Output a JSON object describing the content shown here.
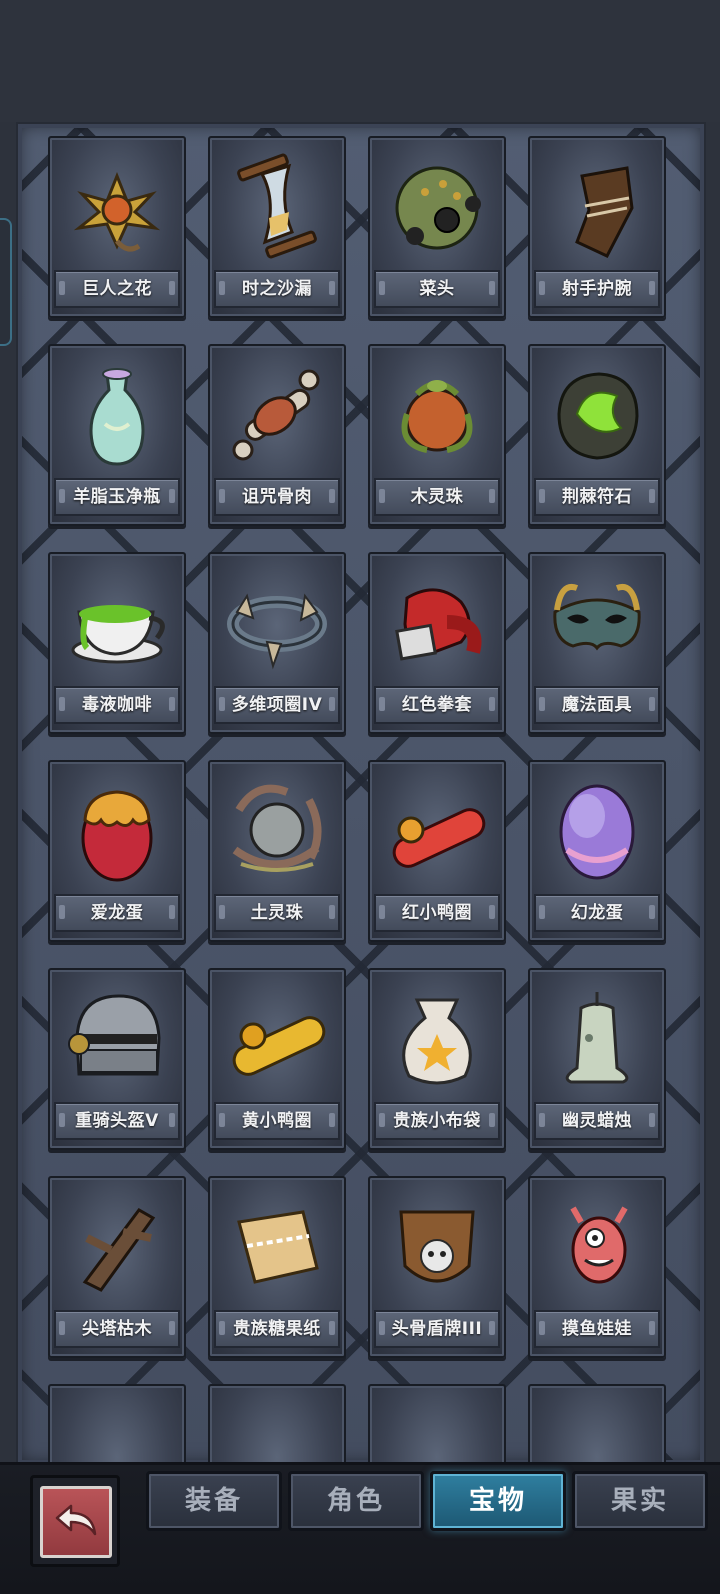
{
  "tabs": [
    {
      "label": "装备"
    },
    {
      "label": "角色"
    },
    {
      "label": "宝物"
    },
    {
      "label": "果实"
    }
  ],
  "active_tab": "宝物",
  "items": [
    {
      "name": "巨人之花",
      "icon": "giant-flower-icon"
    },
    {
      "name": "时之沙漏",
      "icon": "hourglass-icon"
    },
    {
      "name": "菜头",
      "icon": "spiked-ball-icon"
    },
    {
      "name": "射手护腕",
      "icon": "archer-bracer-icon"
    },
    {
      "name": "羊脂玉净瓶",
      "icon": "jade-vase-icon"
    },
    {
      "name": "诅咒骨肉",
      "icon": "cursed-bone-meat-icon"
    },
    {
      "name": "木灵珠",
      "icon": "wood-spirit-orb-icon"
    },
    {
      "name": "荆棘符石",
      "icon": "thorn-rune-stone-icon"
    },
    {
      "name": "毒液咖啡",
      "icon": "venom-coffee-icon"
    },
    {
      "name": "多维项圈IV",
      "icon": "multi-collar-icon"
    },
    {
      "name": "红色拳套",
      "icon": "boxing-glove-icon"
    },
    {
      "name": "魔法面具",
      "icon": "magic-mask-icon"
    },
    {
      "name": "爱龙蛋",
      "icon": "love-dragon-egg-icon"
    },
    {
      "name": "土灵珠",
      "icon": "earth-spirit-orb-icon"
    },
    {
      "name": "红小鸭圈",
      "icon": "red-duck-ring-icon"
    },
    {
      "name": "幻龙蛋",
      "icon": "phantom-dragon-egg-icon"
    },
    {
      "name": "重骑头盔V",
      "icon": "heavy-knight-helmet-icon"
    },
    {
      "name": "黄小鸭圈",
      "icon": "yellow-duck-ring-icon"
    },
    {
      "name": "贵族小布袋",
      "icon": "noble-cloth-bag-icon"
    },
    {
      "name": "幽灵蜡烛",
      "icon": "ghost-candle-icon"
    },
    {
      "name": "尖塔枯木",
      "icon": "spire-deadwood-icon"
    },
    {
      "name": "贵族糖果纸",
      "icon": "noble-candy-wrapper-icon"
    },
    {
      "name": "头骨盾牌III",
      "icon": "skull-shield-icon"
    },
    {
      "name": "摸鱼娃娃",
      "icon": "slacker-doll-icon"
    },
    {
      "name": "",
      "icon": "partial-item-icon"
    },
    {
      "name": "",
      "icon": "partial-item-icon"
    },
    {
      "name": "",
      "icon": "partial-item-icon"
    },
    {
      "name": "",
      "icon": "partial-item-icon"
    }
  ],
  "back_button": {
    "icon": "back-arrow-icon"
  }
}
